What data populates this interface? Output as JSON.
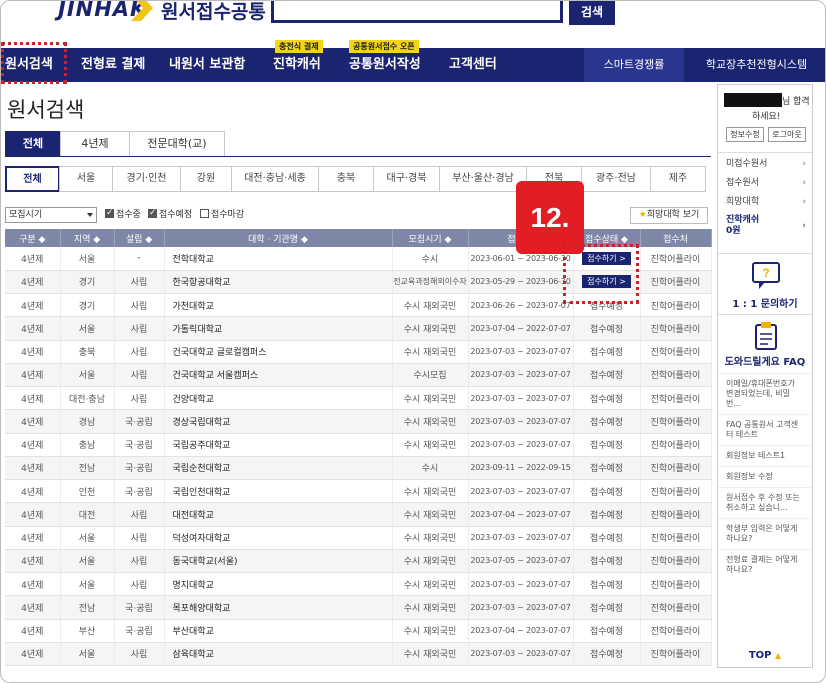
{
  "header": {
    "logo_text": "JINHAK",
    "logo_kor": "원서접수공통",
    "search_button": "검색"
  },
  "nav": {
    "items": [
      {
        "label": "원서검색"
      },
      {
        "label": "전형료 결제"
      },
      {
        "label": "내원서 보관함"
      },
      {
        "label": "진학캐쉬",
        "badge": "충전식 결제"
      },
      {
        "label": "공통원서작성",
        "badge": "공통원서접수 오픈"
      },
      {
        "label": "고객센터"
      }
    ],
    "smart": "스마트경쟁률",
    "school": "학교장추천전형시스템"
  },
  "page_title": "원서검색",
  "type_tabs": [
    "전체",
    "4년제",
    "전문대학(교)"
  ],
  "region_tabs": [
    "전체",
    "서울",
    "경기·인천",
    "강원",
    "대전·충남·세종",
    "충북",
    "대구·경북",
    "부산·울산·경남",
    "전북",
    "광주·전남",
    "제주"
  ],
  "filter": {
    "select_value": "모집시기",
    "checks": [
      {
        "label": "접수중",
        "checked": true
      },
      {
        "label": "접수예정",
        "checked": true
      },
      {
        "label": "접수마감",
        "checked": false
      }
    ],
    "wish_button": "희망대학 보기"
  },
  "table": {
    "headers": [
      "구분 ◆",
      "지역 ◆",
      "설립 ◆",
      "대학 · 기관명 ◆",
      "모집시기 ◆",
      "접수 ◆",
      "접수상태 ◆",
      "접수처"
    ],
    "rows": [
      [
        "4년제",
        "서울",
        "-",
        "전학대학교",
        "수시",
        "2023-06-01 ~ 2023-06-30",
        "접수하기 >",
        "진학어플라이"
      ],
      [
        "4년제",
        "경기",
        "사립",
        "한국항공대학교",
        "전교육과정해외이수자",
        "2023-05-29 ~ 2023-06-30",
        "접수하기 >",
        "진학어플라이"
      ],
      [
        "4년제",
        "경기",
        "사립",
        "가천대학교",
        "수시 재외국민",
        "2023-06-26 ~ 2023-07-07",
        "접수예정",
        "진학어플라이"
      ],
      [
        "4년제",
        "서울",
        "사립",
        "가톨릭대학교",
        "수시 재외국민",
        "2023-07-04 ~ 2022-07-07",
        "접수예정",
        "진학어플라이"
      ],
      [
        "4년제",
        "충북",
        "사립",
        "건국대학교 글로컬캠퍼스",
        "수시 재외국민",
        "2023-07-03 ~ 2023-07-07",
        "접수예정",
        "진학어플라이"
      ],
      [
        "4년제",
        "서울",
        "사립",
        "건국대학교 서울캠퍼스",
        "수시모집",
        "2023-07-03 ~ 2023-07-07",
        "접수예정",
        "진학어플라이"
      ],
      [
        "4년제",
        "대전·충남",
        "사립",
        "건양대학교",
        "수시 재외국민",
        "2023-07-03 ~ 2023-07-07",
        "접수예정",
        "진학어플라이"
      ],
      [
        "4년제",
        "경남",
        "국·공립",
        "경상국립대학교",
        "수시 재외국민",
        "2023-07-03 ~ 2023-07-07",
        "접수예정",
        "진학어플라이"
      ],
      [
        "4년제",
        "충남",
        "국·공립",
        "국립공주대학교",
        "수시 재외국민",
        "2023-07-03 ~ 2023-07-07",
        "접수예정",
        "진학어플라이"
      ],
      [
        "4년제",
        "전남",
        "국·공립",
        "국립순천대학교",
        "수시",
        "2023-09-11 ~ 2022-09-15",
        "접수예정",
        "진학어플라이"
      ],
      [
        "4년제",
        "인천",
        "국·공립",
        "국립인천대학교",
        "수시 재외국민",
        "2023-07-03 ~ 2023-07-07",
        "접수예정",
        "진학어플라이"
      ],
      [
        "4년제",
        "대전",
        "사립",
        "대전대학교",
        "수시 재외국민",
        "2023-07-04 ~ 2023-07-07",
        "접수예정",
        "진학어플라이"
      ],
      [
        "4년제",
        "서울",
        "사립",
        "덕성여자대학교",
        "수시 재외국민",
        "2023-07-03 ~ 2023-07-07",
        "접수예정",
        "진학어플라이"
      ],
      [
        "4년제",
        "서울",
        "사립",
        "동국대학교(서울)",
        "수시 재외국민",
        "2023-07-05 ~ 2023-07-07",
        "접수예정",
        "진학어플라이"
      ],
      [
        "4년제",
        "서울",
        "사립",
        "명지대학교",
        "수시 재외국민",
        "2023-07-03 ~ 2023-07-07",
        "접수예정",
        "진학어플라이"
      ],
      [
        "4년제",
        "전남",
        "국·공립",
        "목포해양대학교",
        "수시 재외국민",
        "2023-07-03 ~ 2023-07-07",
        "접수예정",
        "진학어플라이"
      ],
      [
        "4년제",
        "부산",
        "국·공립",
        "부산대학교",
        "수시 재외국민",
        "2023-07-04 ~ 2023-07-07",
        "접수예정",
        "진학어플라이"
      ],
      [
        "4년제",
        "서울",
        "사립",
        "삼육대학교",
        "수시 재외국민",
        "2023-07-03 ~ 2023-07-07",
        "접수예정",
        "진학어플라이"
      ]
    ]
  },
  "step_badge": "12.",
  "sidebar": {
    "greet1": "님 합격",
    "greet2": "하세요!",
    "btn_info": "정보수정",
    "btn_logout": "로그아웃",
    "menu": [
      "미접수원서",
      "접수원서",
      "희망대학"
    ],
    "cash_label": "진학캐쉬",
    "cash_value": "0원",
    "qna": "1 : 1 문의하기",
    "faq": "도와드릴게요 FAQ",
    "faq_items": [
      "이메일/휴대폰번호가 변경되었는데, 비밀번...",
      "FAQ 공통원서 고객센터 테스트",
      "회원정보 테스트1",
      "회원정보 수정",
      "원서접수 후 수정 또는 취소하고 싶습니...",
      "학생부 입력은 어떻게 하나요?",
      "전형료 결제는 어떻게 하나요?"
    ],
    "top": "TOP"
  }
}
